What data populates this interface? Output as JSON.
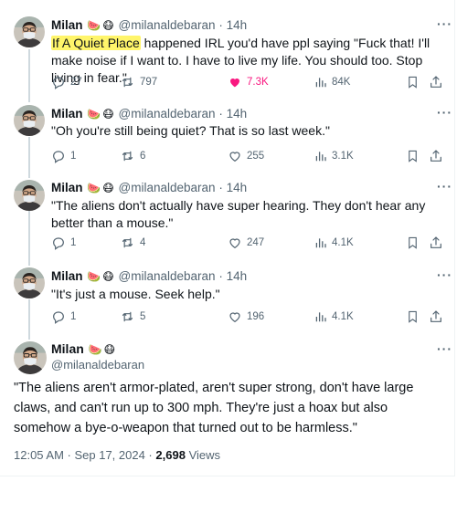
{
  "author": {
    "name": "Milan",
    "emojis": [
      "🍉",
      "😷"
    ],
    "handle": "@milanaldebaran"
  },
  "tweets": [
    {
      "time": "14h",
      "text_highlight": "If A Quiet Place",
      "text_rest": " happened IRL you'd have ppl saying \"Fuck that! I'll make noise if I want to. I have to live my life. You should too. Stop living in fear.\"",
      "replies": "27",
      "reposts": "797",
      "likes": "7.3K",
      "views": "84K",
      "liked": true
    },
    {
      "time": "14h",
      "text": "\"Oh you're still being quiet? That is so last week.\"",
      "replies": "1",
      "reposts": "6",
      "likes": "255",
      "views": "3.1K"
    },
    {
      "time": "14h",
      "text": "\"The aliens don't actually have super hearing. They don't hear any better than a mouse.\"",
      "replies": "1",
      "reposts": "4",
      "likes": "247",
      "views": "4.1K"
    },
    {
      "time": "14h",
      "text": "\"It's just a mouse. Seek help.\"",
      "replies": "1",
      "reposts": "5",
      "likes": "196",
      "views": "4.1K"
    }
  ],
  "main_tweet": {
    "text": "\"The aliens aren't armor-plated, aren't super strong, don't have large claws, and can't run up to 300 mph. They're just a hoax but also somehow a bye-o-weapon that turned out to be harmless.\"",
    "timestamp": "12:05 AM · Sep 17, 2024 · ",
    "views_count": "2,698",
    "views_label": "Views"
  },
  "ui": {
    "separator": "·",
    "more": "···"
  },
  "colors": {
    "highlight": "#fff56a",
    "like": "#f91880",
    "muted": "#536471"
  }
}
